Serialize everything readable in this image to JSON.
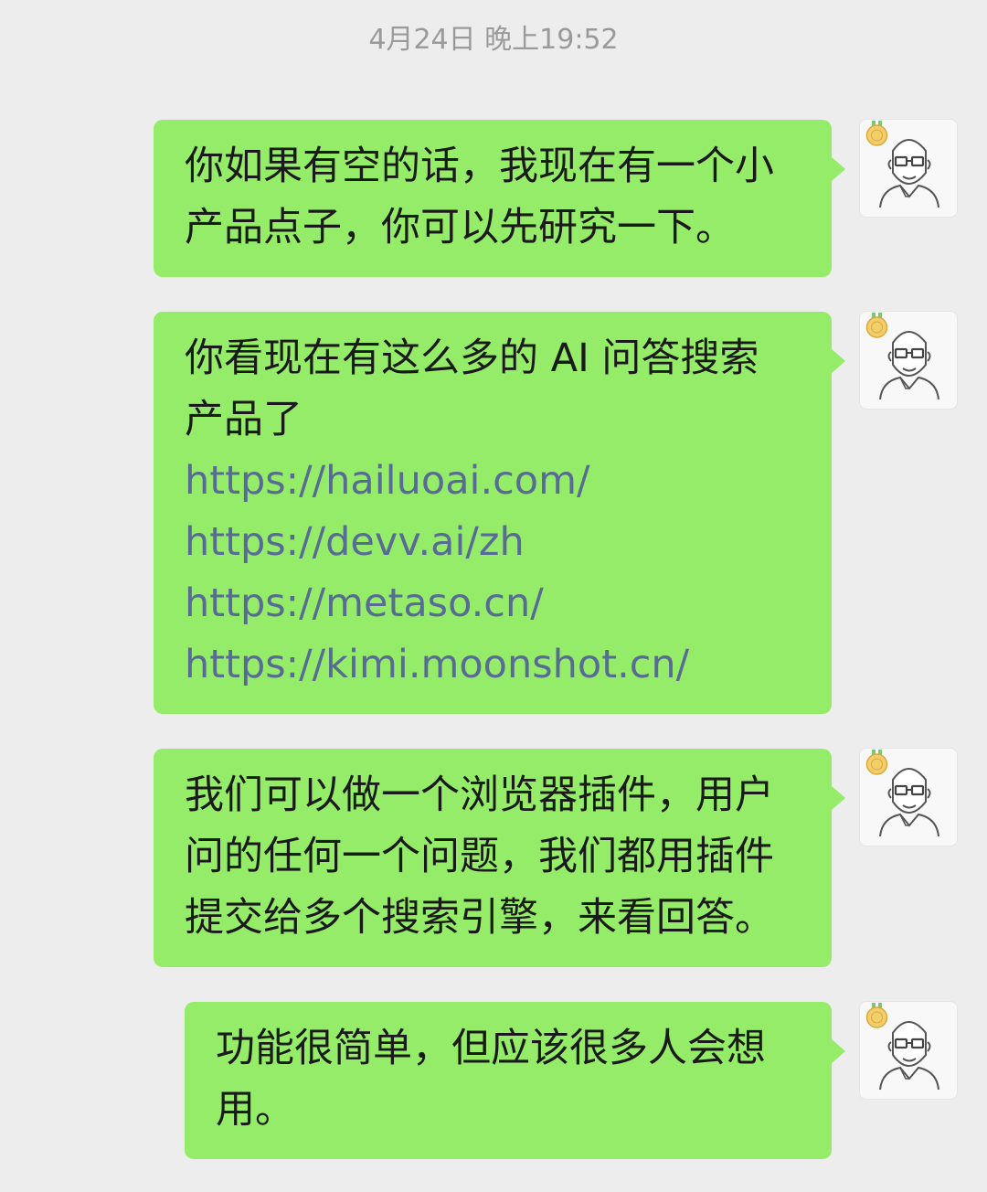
{
  "chat": {
    "timestamp": "4月24日 晚上19:52",
    "messages": [
      {
        "lines": [
          "你如果有空的话，我现在有一个小",
          "产品点子，你可以先研究一下。"
        ]
      },
      {
        "lines": [
          "你看现在有这么多的 AI 问答搜索",
          "产品了"
        ],
        "links": [
          "https://hailuoai.com/",
          "https://devv.ai/zh",
          "https://metaso.cn/",
          "https://kimi.moonshot.cn/"
        ]
      },
      {
        "lines": [
          "我们可以做一个浏览器插件，用户",
          "问的任何一个问题，我们都用插件",
          "提交给多个搜索引擎，来看回答。"
        ]
      },
      {
        "lines": [
          "功能很简单，但应该很多人会想",
          "用。"
        ]
      }
    ],
    "avatar": {
      "icon": "bald-man-glasses-avatar-icon",
      "badge_icon": "medal-badge-icon"
    }
  }
}
